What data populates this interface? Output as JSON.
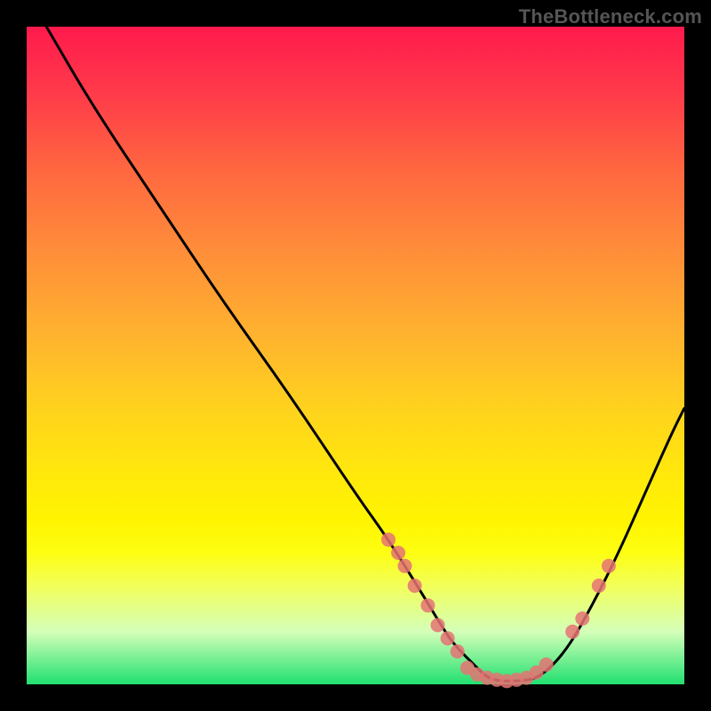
{
  "watermark": "TheBottleneck.com",
  "colors": {
    "frame": "#000000",
    "curve": "#000000",
    "point": "#e57373",
    "gradient_stops": [
      "#ff1a4d",
      "#ff3a4a",
      "#ff6840",
      "#ff8a3a",
      "#ffb030",
      "#ffd21e",
      "#ffe80c",
      "#fff400",
      "#fdfe12",
      "#f2ff5a",
      "#d4ffb9",
      "#20e070"
    ]
  },
  "chart_data": {
    "type": "line",
    "title": "",
    "xlabel": "",
    "ylabel": "",
    "xlim": [
      0,
      100
    ],
    "ylim": [
      0,
      100
    ],
    "x": [
      3,
      10,
      20,
      30,
      40,
      50,
      55,
      60,
      63,
      65,
      68,
      70,
      72,
      75,
      78,
      82,
      86,
      90,
      94,
      98,
      100
    ],
    "values": [
      100,
      88,
      73,
      58,
      44,
      29,
      22,
      14,
      9,
      6,
      3,
      1,
      0.5,
      0.5,
      1,
      5,
      12,
      20,
      29,
      38,
      42
    ],
    "series": [
      {
        "name": "points-left-slope",
        "x": [
          55,
          56.5,
          57.5,
          59,
          61,
          62.5,
          64,
          65.5
        ],
        "y": [
          22,
          20,
          18,
          15,
          12,
          9,
          7,
          5
        ]
      },
      {
        "name": "points-valley",
        "x": [
          67,
          68.5,
          70,
          71.5,
          73,
          74.5,
          76,
          77.5,
          79
        ],
        "y": [
          2.5,
          1.5,
          1,
          0.7,
          0.5,
          0.7,
          1,
          1.8,
          3
        ]
      },
      {
        "name": "points-right-slope",
        "x": [
          83,
          84.5,
          87,
          88.5
        ],
        "y": [
          8,
          10,
          15,
          18
        ]
      }
    ]
  }
}
